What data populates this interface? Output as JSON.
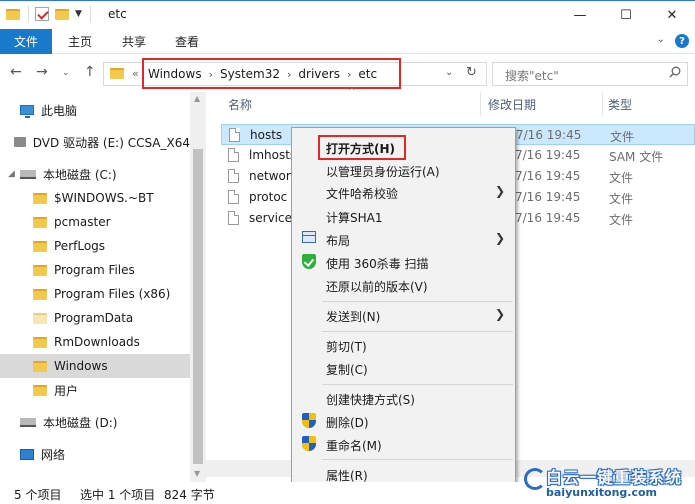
{
  "window": {
    "title": "etc",
    "minimize_glyph": "—",
    "maximize_glyph": "☐",
    "close_glyph": "✕"
  },
  "ribbon": {
    "file_tab": "文件",
    "tabs": [
      "主页",
      "共享",
      "查看"
    ]
  },
  "address": {
    "overflow": "«",
    "crumbs": [
      "Windows",
      "System32",
      "drivers",
      "etc"
    ],
    "search_placeholder": "搜索\"etc\""
  },
  "nav_pane": {
    "items": [
      {
        "label": "此电脑",
        "icon": "pc-icon"
      },
      {
        "label": "DVD 驱动器 (E:) CCSA_X64",
        "icon": "dvd-drive-icon"
      },
      {
        "label": "本地磁盘 (C:)",
        "icon": "disk-icon"
      },
      {
        "label": "$WINDOWS.~BT",
        "icon": "folder-icon"
      },
      {
        "label": "pcmaster",
        "icon": "folder-icon"
      },
      {
        "label": "PerfLogs",
        "icon": "folder-icon"
      },
      {
        "label": "Program Files",
        "icon": "folder-icon"
      },
      {
        "label": "Program Files (x86)",
        "icon": "folder-icon"
      },
      {
        "label": "ProgramData",
        "icon": "folder-icon"
      },
      {
        "label": "RmDownloads",
        "icon": "folder-icon"
      },
      {
        "label": "Windows",
        "icon": "folder-icon"
      },
      {
        "label": "用户",
        "icon": "folder-icon"
      },
      {
        "label": "本地磁盘 (D:)",
        "icon": "disk-icon"
      },
      {
        "label": "网络",
        "icon": "network-icon"
      }
    ]
  },
  "file_list": {
    "columns": {
      "name": "名称",
      "modified": "修改日期",
      "type": "类型"
    },
    "rows": [
      {
        "name": "hosts",
        "date": "7/16 19:45",
        "type": "文件"
      },
      {
        "name": "lmhosts",
        "date": "7/16 19:45",
        "type": "SAM 文件"
      },
      {
        "name": "networ",
        "date": "7/16 19:45",
        "type": "文件"
      },
      {
        "name": "protoc",
        "date": "7/16 19:45",
        "type": "文件"
      },
      {
        "name": "services",
        "date": "7/16 19:45",
        "type": "文件"
      }
    ]
  },
  "context_menu": {
    "items": [
      {
        "label": "打开方式(H)",
        "icon": "",
        "submenu": false,
        "bold": true
      },
      {
        "label": "以管理员身份运行(A)",
        "icon": "",
        "submenu": false
      },
      {
        "label": "文件哈希校验",
        "icon": "",
        "submenu": true
      },
      {
        "label": "计算SHA1",
        "icon": "",
        "submenu": false
      },
      {
        "label": "布局",
        "icon": "layout-icon",
        "submenu": true
      },
      {
        "label": "使用 360杀毒 扫描",
        "icon": "360-shield-icon",
        "submenu": false
      },
      {
        "label": "还原以前的版本(V)",
        "icon": "",
        "submenu": false
      },
      {
        "label": "发送到(N)",
        "icon": "",
        "submenu": true
      },
      {
        "label": "剪切(T)",
        "icon": "",
        "submenu": false
      },
      {
        "label": "复制(C)",
        "icon": "",
        "submenu": false
      },
      {
        "label": "创建快捷方式(S)",
        "icon": "",
        "submenu": false
      },
      {
        "label": "删除(D)",
        "icon": "uac-shield-icon",
        "submenu": false
      },
      {
        "label": "重命名(M)",
        "icon": "uac-shield-icon",
        "submenu": false
      },
      {
        "label": "属性(R)",
        "icon": "",
        "submenu": false
      }
    ]
  },
  "status_bar": {
    "item_count": "5 个项目",
    "selection": "选中 1 个项目",
    "size": "824 字节"
  },
  "watermark": {
    "logo_text": "白云一键重装系统",
    "url": "baiyunxitong.com"
  },
  "colors": {
    "accent": "#1979ca",
    "highlight_box": "#e32626",
    "selection": "#cce8ff"
  }
}
